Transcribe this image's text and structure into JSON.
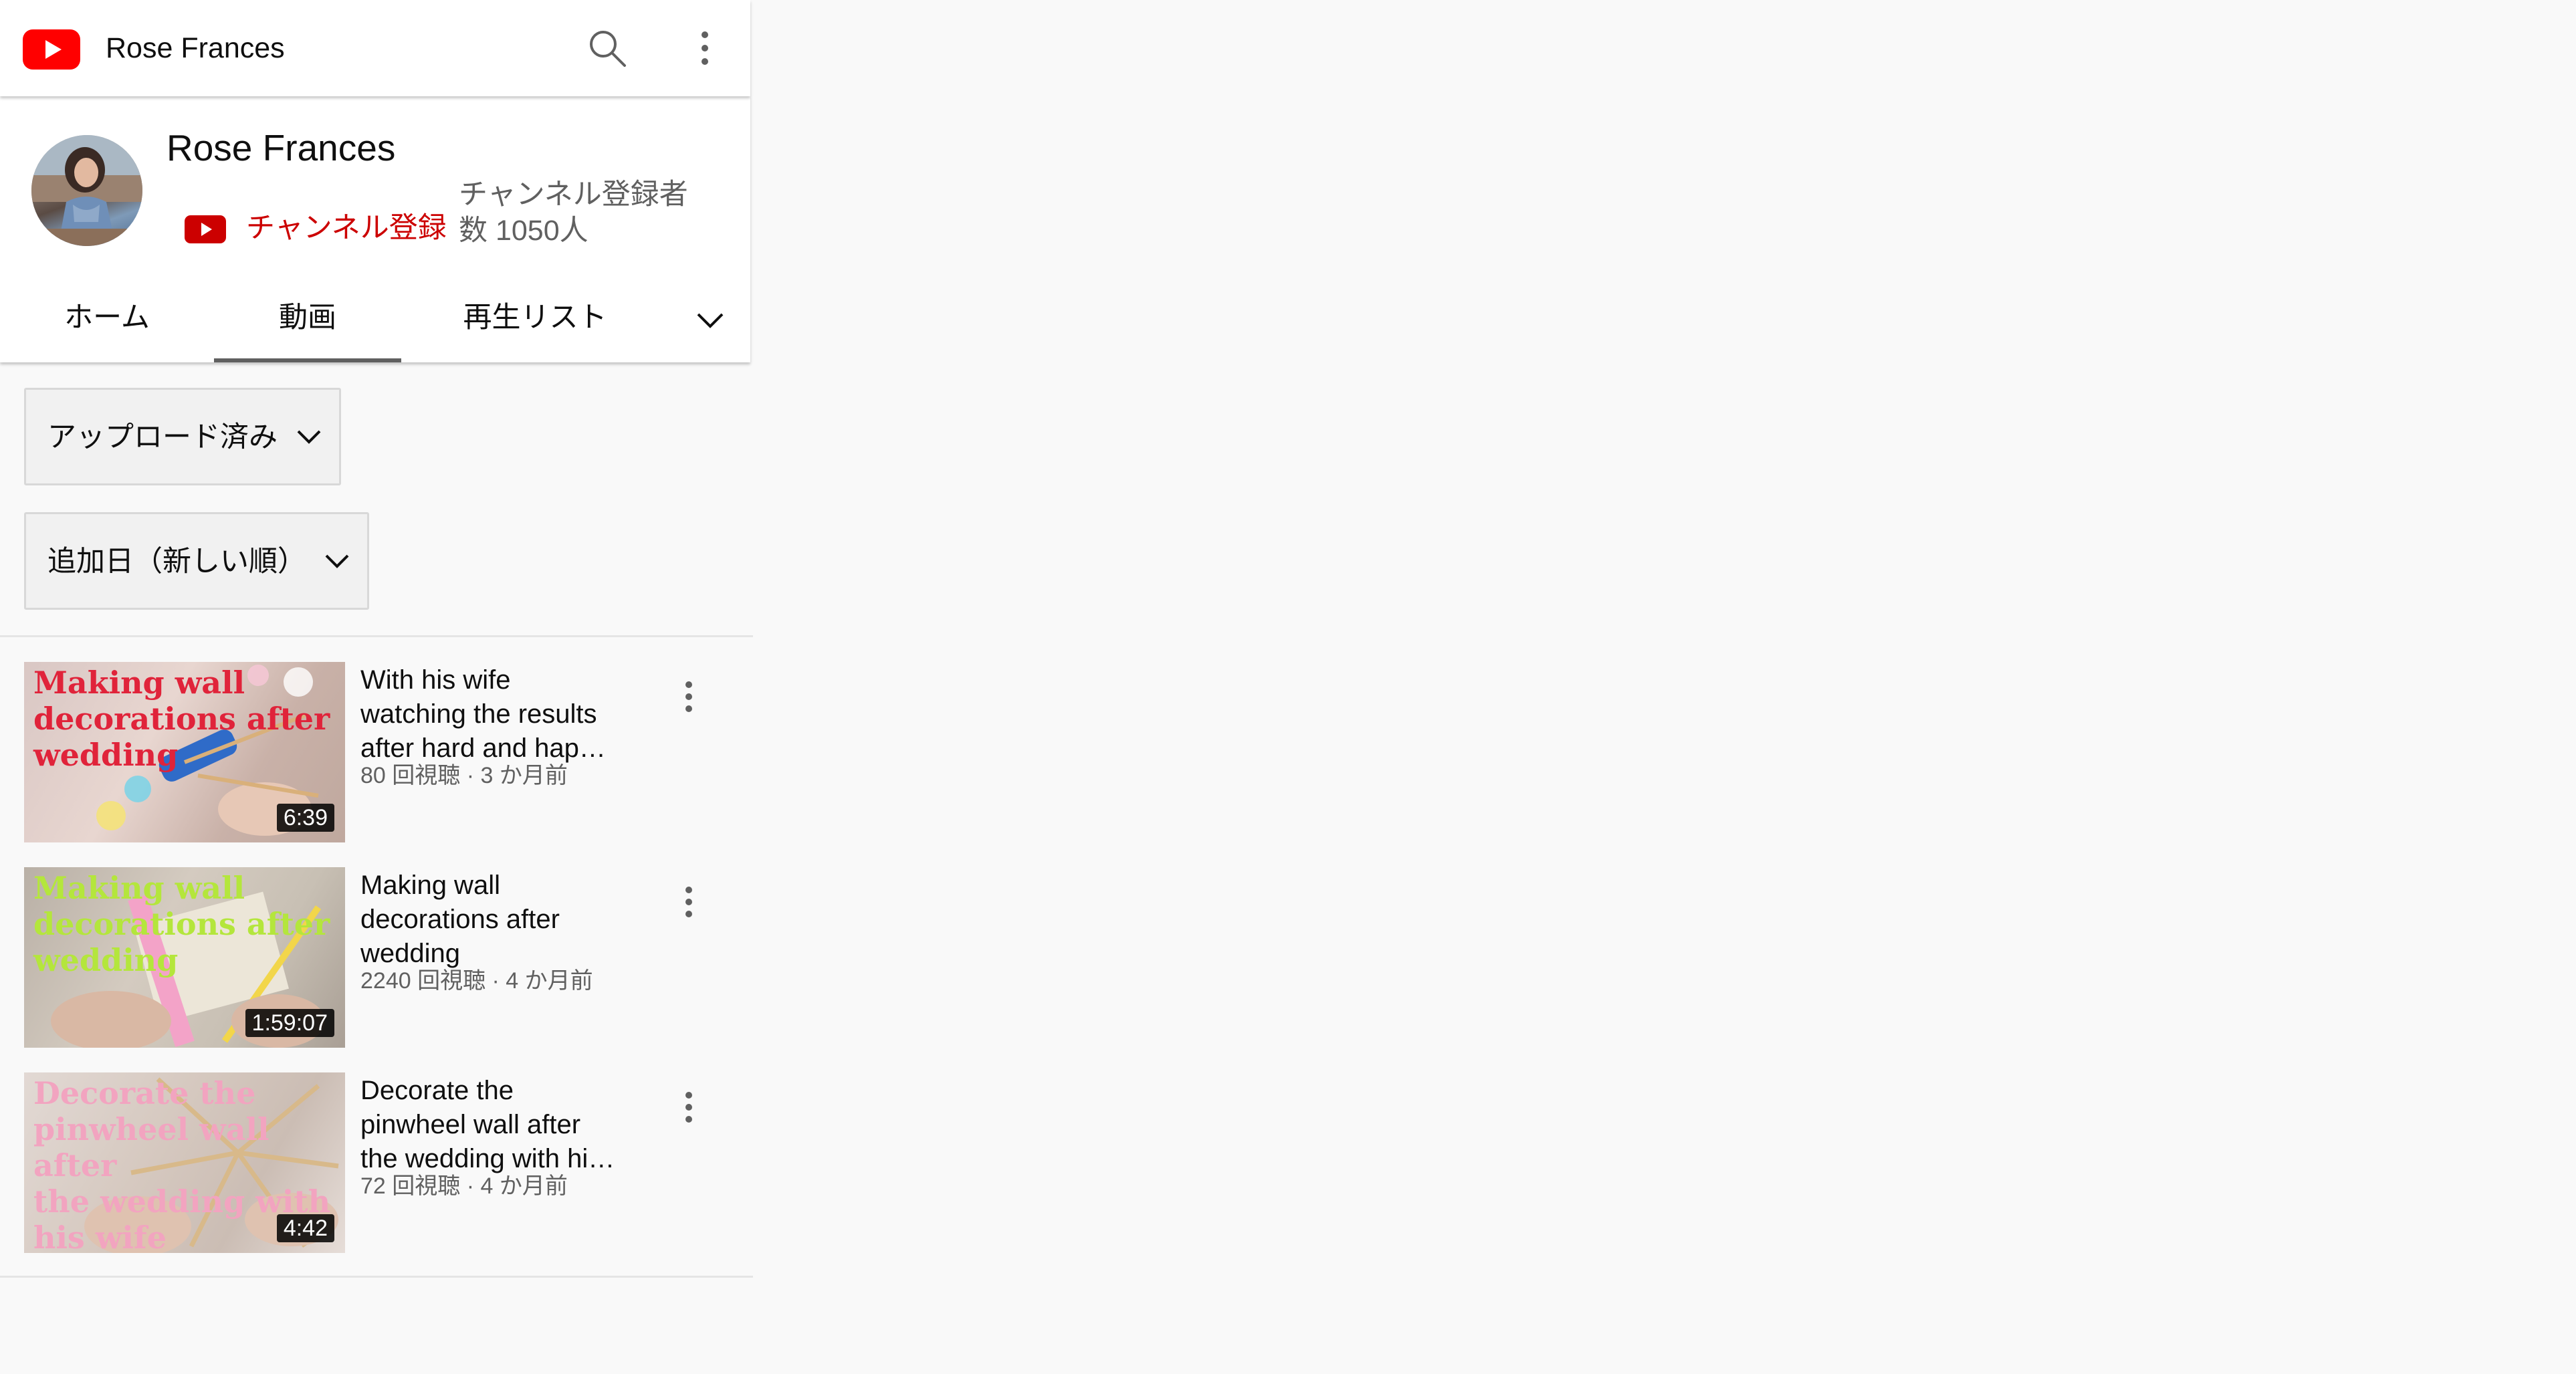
{
  "topbar": {
    "logo_icon": "youtube-logo-icon",
    "title": "Rose Frances",
    "search_icon": "search-icon",
    "more_icon": "more-vertical-icon"
  },
  "channel": {
    "name": "Rose Frances",
    "subscribe_label": "チャンネル登録",
    "subscriber_count": "チャンネル登録者数 1050人",
    "accent_color": "#cc0000"
  },
  "tabs": [
    {
      "label": "ホーム",
      "selected": false
    },
    {
      "label": "動画",
      "selected": true
    },
    {
      "label": "再生リスト",
      "selected": false
    }
  ],
  "tabs_more_icon": "chevron-down-icon",
  "filters": {
    "upload_type": "アップロード済み",
    "sort_order": "追加日（新しい順）"
  },
  "videos": [
    {
      "thumb_text": "Making wall\ndecorations after\nwedding",
      "duration": "6:39",
      "title_lines": [
        "With his wife",
        "watching the results",
        "after hard and hap…"
      ],
      "meta": "80 回視聴 · 3 か月前"
    },
    {
      "thumb_text": "Making wall\ndecorations after\nwedding",
      "duration": "1:59:07",
      "title_lines": [
        "Making wall",
        "decorations after",
        "wedding"
      ],
      "meta": "2240 回視聴 · 4 か月前"
    },
    {
      "thumb_text": "Decorate the\npinwheel wall after\nthe wedding with\nhis wife",
      "duration": "4:42",
      "title_lines": [
        "Decorate the",
        "pinwheel wall after",
        "the wedding with hi…"
      ],
      "meta": "72 回視聴 · 4 か月前"
    }
  ]
}
